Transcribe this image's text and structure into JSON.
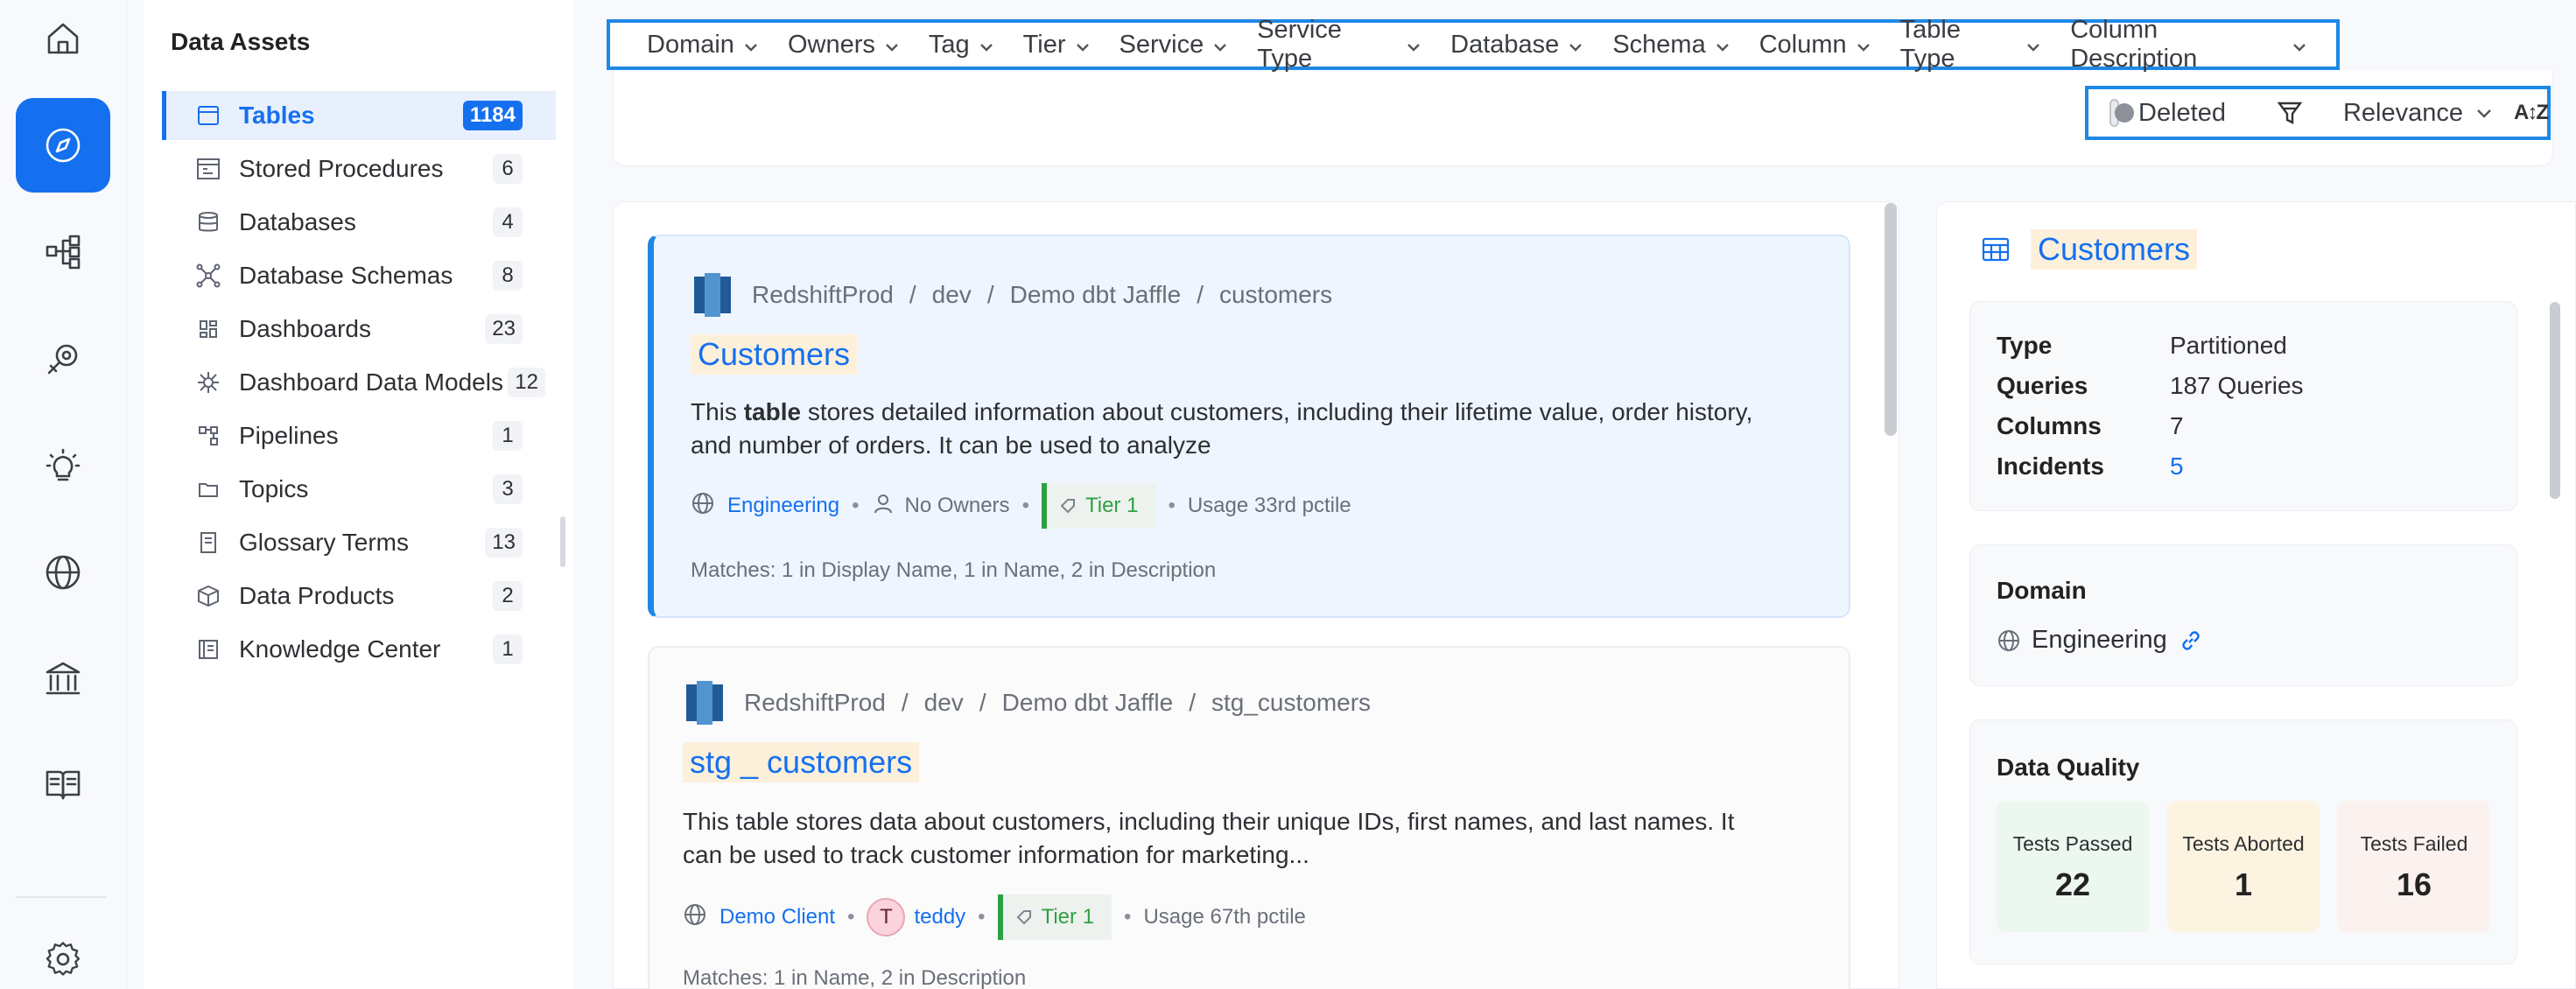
{
  "nav": {
    "items": [
      "home-icon",
      "explore-icon",
      "lineage-icon",
      "observability-icon",
      "insights-icon",
      "domains-icon",
      "governance-icon",
      "docs-icon",
      "settings-icon"
    ]
  },
  "assets": {
    "title": "Data Assets",
    "items": [
      {
        "label": "Tables",
        "count": "1184",
        "icon": "table-icon"
      },
      {
        "label": "Stored Procedures",
        "count": "6",
        "icon": "procedure-icon"
      },
      {
        "label": "Databases",
        "count": "4",
        "icon": "database-icon"
      },
      {
        "label": "Database Schemas",
        "count": "8",
        "icon": "schema-icon"
      },
      {
        "label": "Dashboards",
        "count": "23",
        "icon": "dashboard-icon"
      },
      {
        "label": "Dashboard Data Models",
        "count": "12",
        "icon": "data-model-icon"
      },
      {
        "label": "Pipelines",
        "count": "1",
        "icon": "pipeline-icon"
      },
      {
        "label": "Topics",
        "count": "3",
        "icon": "topic-icon"
      },
      {
        "label": "Glossary Terms",
        "count": "13",
        "icon": "glossary-icon"
      },
      {
        "label": "Data Products",
        "count": "2",
        "icon": "data-product-icon"
      },
      {
        "label": "Knowledge Center",
        "count": "1",
        "icon": "knowledge-icon"
      }
    ]
  },
  "filters": [
    "Domain",
    "Owners",
    "Tag",
    "Tier",
    "Service",
    "Service Type",
    "Database",
    "Schema",
    "Column",
    "Table Type",
    "Column Description"
  ],
  "sort": {
    "deleted_label": "Deleted",
    "relevance_label": "Relevance",
    "sort_icon": "A↕Z"
  },
  "results": [
    {
      "crumbs": [
        "RedshiftProd",
        "dev",
        "Demo dbt Jaffle",
        "customers"
      ],
      "name": "Customers",
      "desc_pre": "This ",
      "desc_bold": "table",
      "desc_post": " stores detailed information about customers, including their lifetime value, order history, and number of orders. It can be used to analyze",
      "domain": "Engineering",
      "owner": "No Owners",
      "tier": "Tier 1",
      "usage": "Usage 33rd pctile",
      "matches": "Matches:  1 in Display Name,  1 in Name,  2 in Description"
    },
    {
      "crumbs": [
        "RedshiftProd",
        "dev",
        "Demo dbt Jaffle",
        "stg_customers"
      ],
      "name": "stg _ customers",
      "desc": "This table stores data about customers, including their unique IDs, first names, and last names. It can be used to track customer information for marketing...",
      "domain": "Demo Client",
      "owner_initial": "T",
      "owner": "teddy",
      "tier": "Tier 1",
      "usage": "Usage 67th pctile",
      "matches": "Matches:  1 in Name,  2 in Description"
    }
  ],
  "detail": {
    "title": "Customers",
    "props": [
      {
        "k": "Type",
        "v": "Partitioned"
      },
      {
        "k": "Queries",
        "v": "187 Queries"
      },
      {
        "k": "Columns",
        "v": "7"
      },
      {
        "k": "Incidents",
        "v": "5"
      }
    ],
    "domain_heading": "Domain",
    "domain_value": "Engineering",
    "dq_heading": "Data Quality",
    "dq": [
      {
        "label": "Tests Passed",
        "value": "22",
        "color": "#ecf7ef"
      },
      {
        "label": "Tests Aborted",
        "value": "1",
        "color": "#fdf3e1"
      },
      {
        "label": "Tests Failed",
        "value": "16",
        "color": "#fbf1ee"
      }
    ]
  },
  "colors": {
    "accent": "#1570ef",
    "tier": "#2ea043",
    "highlight": "#fdf0db"
  }
}
